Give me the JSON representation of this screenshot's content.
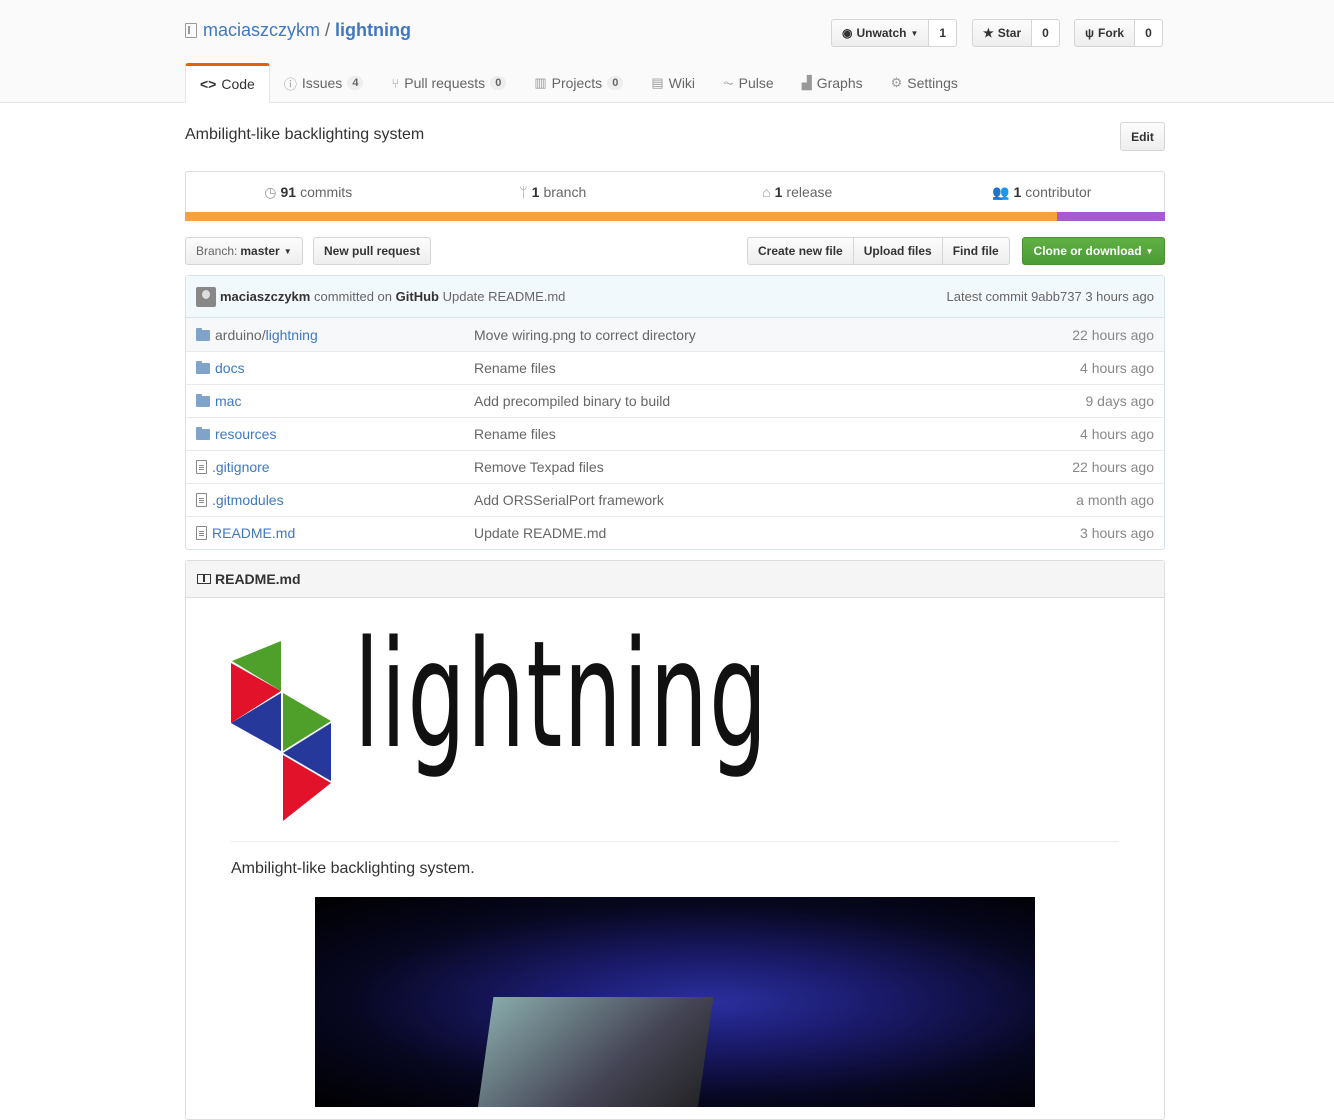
{
  "repo": {
    "owner": "maciaszczykm",
    "separator": "/",
    "name": "lightning"
  },
  "actions": [
    {
      "icon": "eye-icon",
      "label": "Unwatch",
      "count": "1"
    },
    {
      "icon": "star-icon",
      "label": "Star",
      "count": "0"
    },
    {
      "icon": "fork-icon",
      "label": "Fork",
      "count": "0"
    }
  ],
  "tabs": [
    {
      "label": "Code",
      "counter": ""
    },
    {
      "label": "Issues",
      "counter": "4"
    },
    {
      "label": "Pull requests",
      "counter": "0"
    },
    {
      "label": "Projects",
      "counter": "0"
    },
    {
      "label": "Wiki",
      "counter": ""
    },
    {
      "label": "Pulse",
      "counter": ""
    },
    {
      "label": "Graphs",
      "counter": ""
    },
    {
      "label": "Settings",
      "counter": ""
    }
  ],
  "description": "Ambilight-like backlighting system",
  "edit_label": "Edit",
  "summary": [
    {
      "num": "91",
      "label": "commits"
    },
    {
      "num": "1",
      "label": "branch"
    },
    {
      "num": "1",
      "label": "release"
    },
    {
      "num": "1",
      "label": "contributor"
    }
  ],
  "languages": [
    {
      "color": "#f6a13b",
      "fraction": 0.89
    },
    {
      "color": "#a65ccf",
      "fraction": 0.11
    }
  ],
  "branch": {
    "label": "Branch:",
    "value": "master"
  },
  "new_pr_label": "New pull request",
  "file_actions": [
    "Create new file",
    "Upload files",
    "Find file"
  ],
  "clone_label": "Clone or download",
  "commit": {
    "author": "maciaszczykm",
    "verb": "committed on",
    "via": "GitHub",
    "message": "Update README.md",
    "latest_label": "Latest commit",
    "sha": "9abb737",
    "age": "3 hours ago"
  },
  "files": [
    {
      "type": "folder",
      "prefix": "arduino/",
      "name": "lightning",
      "message": "Move wiring.png to correct directory",
      "age": "22 hours ago"
    },
    {
      "type": "folder",
      "prefix": "",
      "name": "docs",
      "message": "Rename files",
      "age": "4 hours ago"
    },
    {
      "type": "folder",
      "prefix": "",
      "name": "mac",
      "message": "Add precompiled binary to build",
      "age": "9 days ago"
    },
    {
      "type": "folder",
      "prefix": "",
      "name": "resources",
      "message": "Rename files",
      "age": "4 hours ago"
    },
    {
      "type": "file",
      "prefix": "",
      "name": ".gitignore",
      "message": "Remove Texpad files",
      "age": "22 hours ago"
    },
    {
      "type": "file",
      "prefix": "",
      "name": ".gitmodules",
      "message": "Add ORSSerialPort framework",
      "age": "a month ago"
    },
    {
      "type": "file",
      "prefix": "",
      "name": "README.md",
      "message": "Update README.md",
      "age": "3 hours ago"
    }
  ],
  "readme": {
    "title": "README.md",
    "logo_text": "lightning",
    "description": "Ambilight-like backlighting system."
  },
  "colors": {
    "link": "#4078c0",
    "tab_accent": "#e36209",
    "clone_green": "#5aa63e",
    "logo_green": "#4f9f2b",
    "logo_red": "#e3122b",
    "logo_blue": "#26389a"
  }
}
